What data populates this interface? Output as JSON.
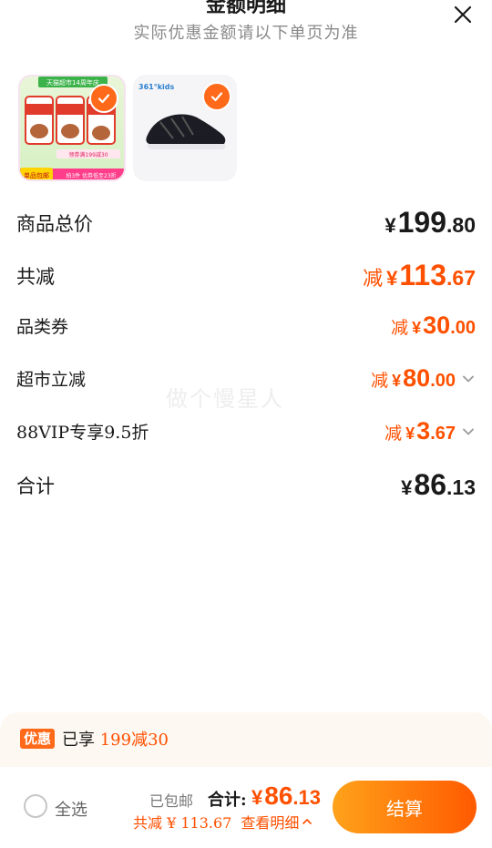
{
  "header": {
    "title": "金额明细",
    "subtitle": "实际优惠金额请以下单页为准"
  },
  "products": [
    {
      "name": "mushroom-product",
      "banner": "天猫超市14周年庆",
      "tag": "单品包邮",
      "coupon": "领券满199减30",
      "promo": "拍3件 优券低至23折"
    },
    {
      "name": "sneaker-product",
      "brand": "361°kids"
    }
  ],
  "summary": {
    "goods_total": {
      "label": "商品总价",
      "currency": "¥",
      "int": "199",
      "dec": ".80"
    },
    "total_discount": {
      "label": "共减",
      "minus": "减",
      "currency": "¥",
      "int": "113",
      "dec": ".67"
    },
    "category_coupon": {
      "label": "品类券",
      "minus": "减",
      "currency": "¥",
      "int": "30",
      "dec": ".00"
    },
    "supermarket_discount": {
      "label": "超市立减",
      "minus": "减",
      "currency": "¥",
      "int": "80",
      "dec": ".00"
    },
    "vip_discount": {
      "label": "88VIP专享9.5折",
      "minus": "减",
      "currency": "¥",
      "int": "3",
      "dec": ".67"
    },
    "sum": {
      "label": "合计",
      "currency": "¥",
      "int": "86",
      "dec": ".13"
    }
  },
  "watermark": "做个慢星人",
  "promo": {
    "badge": "优惠",
    "prefix": "已享",
    "highlight": "199减30"
  },
  "footer": {
    "select_all": "全选",
    "shipping": "已包邮",
    "total_label": "合计:",
    "currency": "¥",
    "total_int": "86",
    "total_dec": ".13",
    "saved": "共减 ¥ 113.67",
    "details": "查看明细"
  },
  "checkout": {
    "label": "结算"
  },
  "colors": {
    "accent": "#ff5000",
    "check": "#ff6a1a"
  }
}
